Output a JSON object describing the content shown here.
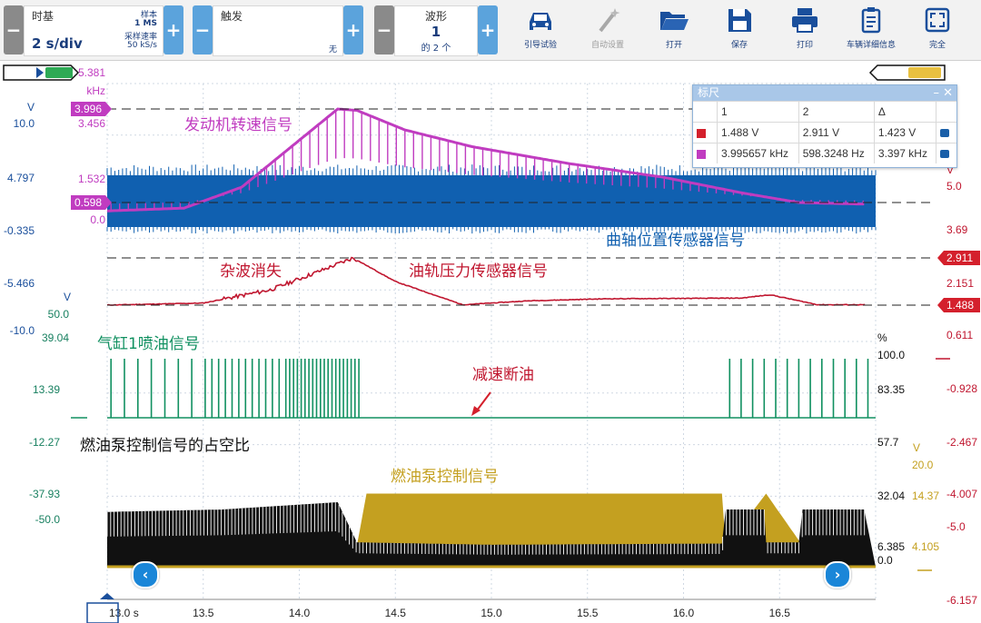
{
  "toolbar": {
    "timebase": {
      "title": "时基",
      "value": "2 s/div",
      "samples_label": "样本",
      "samples_value": "1 MS",
      "rate_label": "采样速率",
      "rate_value": "50 kS/s",
      "minus": "−",
      "plus": "+"
    },
    "trigger": {
      "title": "触发",
      "value": "无",
      "minus": "−",
      "plus": "+"
    },
    "waveform": {
      "title": "波形",
      "value": "1",
      "sub": "的 2 个",
      "minus": "−",
      "plus": "+"
    },
    "tools": [
      {
        "label": "引导试验",
        "icon": "car-icon",
        "enabled": true
      },
      {
        "label": "自动设置",
        "icon": "wand-icon",
        "enabled": false
      },
      {
        "label": "打开",
        "icon": "folder-icon",
        "enabled": true
      },
      {
        "label": "保存",
        "icon": "save-icon",
        "enabled": true
      },
      {
        "label": "打印",
        "icon": "printer-icon",
        "enabled": true
      },
      {
        "label": "车辆详细信息",
        "icon": "clipboard-icon",
        "enabled": true
      },
      {
        "label": "完全",
        "icon": "fullscreen-icon",
        "enabled": true
      }
    ]
  },
  "colors": {
    "rpm": "#c03cc0",
    "crank": "#1060b0",
    "rail": "#c0162f",
    "injector": "#109060",
    "pump_duty": "#111111",
    "pump_ctrl": "#c4a020",
    "axis_blue": "#1a4f9c",
    "axis_green": "#188060"
  },
  "axes": {
    "left_v": {
      "unit": "V",
      "ticks": [
        "10.0",
        "4.797",
        "-0.335",
        "-5.466",
        "-10.0"
      ]
    },
    "freq": {
      "ticks": [
        "5.381",
        "3.456",
        "1.532",
        "0.0"
      ],
      "unit": "kHz",
      "marker_top": "3.996",
      "marker_bottom": "0.598"
    },
    "rail_v": {
      "unit": "V",
      "ticks": [
        "50.0",
        "39.04"
      ]
    },
    "injector": {
      "ticks": [
        "13.39",
        "-12.27",
        "-37.93",
        "-50.0"
      ]
    },
    "right_red": {
      "unit": "V",
      "ticks": [
        "5.0",
        "3.69",
        "2.151",
        "0.611",
        "-0.928",
        "-2.467",
        "-4.007",
        "-5.0",
        "-6.157"
      ],
      "marker_top": "2.911",
      "marker_bottom": "1.488"
    },
    "percent": {
      "unit": "%",
      "ticks": [
        "100.0",
        "83.35",
        "57.7",
        "32.04",
        "6.385",
        "0.0"
      ]
    },
    "pump_v": {
      "unit": "V",
      "ticks": [
        "20.0",
        "14.37",
        "4.105"
      ]
    },
    "time": {
      "ticks": [
        "13.0 s",
        "13.5",
        "14.0",
        "14.5",
        "15.0",
        "15.5",
        "16.0",
        "16.5"
      ]
    }
  },
  "annotations": {
    "rpm": "发动机转速信号",
    "crank": "曲轴位置传感器信号",
    "noise": "杂波消失",
    "rail": "油轨压力传感器信号",
    "injector": "气缸1喷油信号",
    "fuel_cut": "减速断油",
    "pump_duty": "燃油泵控制信号的占空比",
    "pump_ctrl": "燃油泵控制信号"
  },
  "ruler": {
    "title": "标尺",
    "col1": "1",
    "col2": "2",
    "delta": "Δ",
    "rows": [
      {
        "color": "#d4202c",
        "v1": "1.488 V",
        "v2": "2.911 V",
        "d": "1.423 V"
      },
      {
        "color": "#c03cc0",
        "v1": "3.995657 kHz",
        "v2": "598.3248 Hz",
        "d": "3.397 kHz"
      }
    ]
  },
  "chart_data": {
    "type": "line",
    "xlabel": "",
    "xlim": [
      13.0,
      17.0
    ],
    "x_ticks": [
      13.0,
      13.5,
      14.0,
      14.5,
      15.0,
      15.5,
      16.0,
      16.5
    ],
    "series": [
      {
        "name": "发动机转速信号",
        "unit": "kHz",
        "x": [
          13.0,
          13.4,
          13.7,
          13.95,
          14.2,
          14.3,
          14.55,
          14.9,
          15.4,
          15.9,
          16.3,
          16.6,
          16.9
        ],
        "values": [
          0.35,
          0.45,
          1.2,
          2.6,
          4.0,
          3.95,
          3.25,
          2.65,
          2.05,
          1.55,
          1.0,
          0.65,
          0.6
        ]
      },
      {
        "name": "油轨压力传感器信号",
        "unit": "V",
        "x": [
          13.0,
          13.5,
          13.85,
          14.1,
          14.28,
          14.5,
          14.85,
          15.2,
          15.6,
          16.0,
          16.3,
          16.45,
          16.7,
          17.0
        ],
        "values": [
          1.49,
          1.55,
          1.95,
          2.5,
          2.91,
          2.2,
          1.5,
          1.62,
          1.68,
          1.69,
          1.7,
          1.8,
          1.5,
          1.5
        ]
      },
      {
        "name": "气缸1喷油信号",
        "pulse_windows_s": [
          [
            13.0,
            14.32
          ],
          [
            16.22,
            17.0
          ]
        ]
      },
      {
        "name": "燃油泵控制信号的占空比",
        "unit": "%",
        "x": [
          13.0,
          13.6,
          14.1,
          14.2,
          14.3,
          15.0,
          16.2,
          16.22,
          16.42,
          16.43,
          16.6,
          16.62,
          17.0
        ],
        "values": [
          45,
          47,
          52,
          53,
          20,
          18,
          19,
          47,
          47,
          20,
          20,
          47,
          47
        ]
      },
      {
        "name": "燃油泵控制信号",
        "unit": "V",
        "x": [
          13.0,
          13.6,
          14.0,
          14.3,
          14.35,
          16.2,
          16.22,
          16.43,
          16.62,
          17.0
        ],
        "values": [
          4.1,
          4.6,
          6.0,
          4.2,
          14.37,
          14.37,
          4.1,
          14.37,
          4.1,
          4.1
        ]
      }
    ]
  },
  "nav": {
    "left": "‹",
    "right": "›"
  }
}
